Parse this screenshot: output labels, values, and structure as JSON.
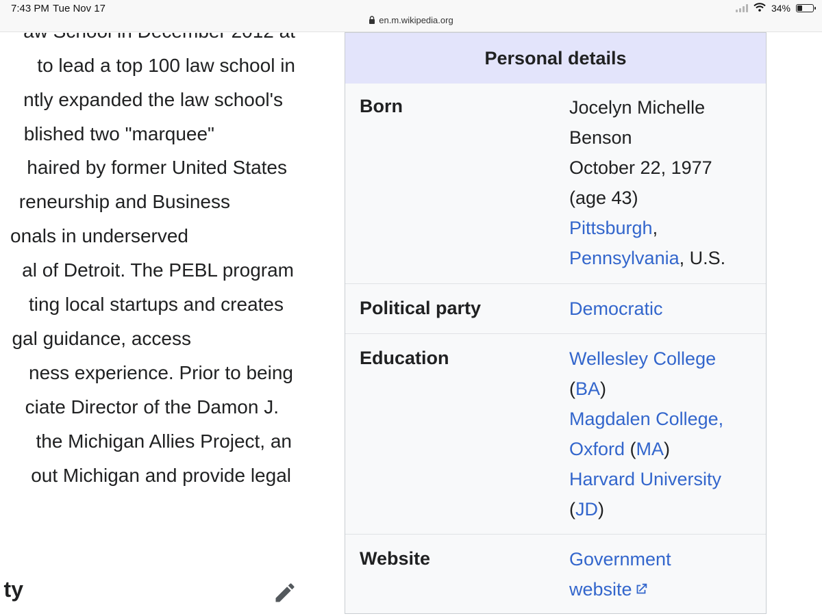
{
  "status_bar": {
    "time": "7:43 PM",
    "date": "Tue Nov 17",
    "url": "en.m.wikipedia.org",
    "battery": "34%",
    "battery_level": 0.34
  },
  "article": {
    "lines": [
      "aw School in December 2012 at",
      "to lead a top 100 law school in",
      "ntly expanded the law school's",
      "blished two \"marquee\"",
      "haired by former United States",
      "reneurship and Business",
      "onals in underserved",
      "al of Detroit. The PEBL program",
      "ting local startups and creates",
      "gal guidance, access",
      "ness experience. Prior to being",
      "ciate Director of the Damon J.",
      "the Michigan Allies Project, an",
      "out Michigan and provide legal"
    ],
    "section_heading": "ty"
  },
  "infobox": {
    "header": "Personal details",
    "born": {
      "label": "Born",
      "name_line1": "Jocelyn Michelle",
      "name_line2": "Benson",
      "date": "October 22, 1977",
      "age": "(age 43)",
      "city": "Pittsburgh",
      "comma": ",",
      "state": "Pennsylvania",
      "country": ", U.S."
    },
    "party": {
      "label": "Political party",
      "value": "Democratic"
    },
    "education": {
      "label": "Education",
      "school1": "Wellesley College",
      "open1": "(",
      "degree1": "BA",
      "close1": ")",
      "school2_line1": "Magdalen College,",
      "school2_line2": "Oxford",
      "open2": " (",
      "degree2": "MA",
      "close2": ")",
      "school3": "Harvard University",
      "open3": "(",
      "degree3": "JD",
      "close3": ")"
    },
    "website": {
      "label": "Website",
      "line1": "Government",
      "line2": "website"
    }
  },
  "colors": {
    "link": "#3366cc",
    "header_bg": "#e3e4fb",
    "infobox_bg": "#f8f9fa",
    "text": "#202122"
  }
}
